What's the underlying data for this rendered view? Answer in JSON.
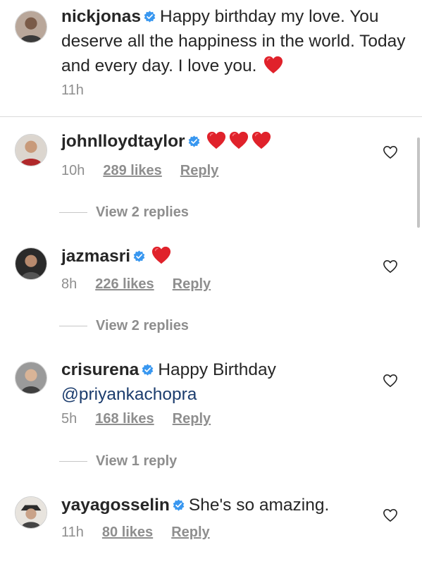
{
  "caption": {
    "username": "nickjonas",
    "text": "Happy birthday my love. You deserve all the happiness in the world. Today and every day. I love you.",
    "time": "11h"
  },
  "comments": [
    {
      "username": "johnlloydtaylor",
      "text": "",
      "hearts": 3,
      "time": "10h",
      "likes": "289 likes",
      "reply": "Reply",
      "view_replies": "View 2 replies"
    },
    {
      "username": "jazmasri",
      "text": "",
      "hearts": 1,
      "time": "8h",
      "likes": "226 likes",
      "reply": "Reply",
      "view_replies": "View 2 replies"
    },
    {
      "username": "crisurena",
      "text": "Happy Birthday",
      "mention": "@priyankachopra",
      "time": "5h",
      "likes": "168 likes",
      "reply": "Reply",
      "view_replies": "View 1 reply"
    },
    {
      "username": "yayagosselin",
      "text": "She's so amazing.",
      "time": "11h",
      "likes": "80 likes",
      "reply": "Reply"
    }
  ],
  "colors": {
    "verified_badge": "#3897f0",
    "heart_emoji": "#e0222b",
    "secondary_text": "#8e8e8e",
    "mention": "#1c3d6e"
  }
}
